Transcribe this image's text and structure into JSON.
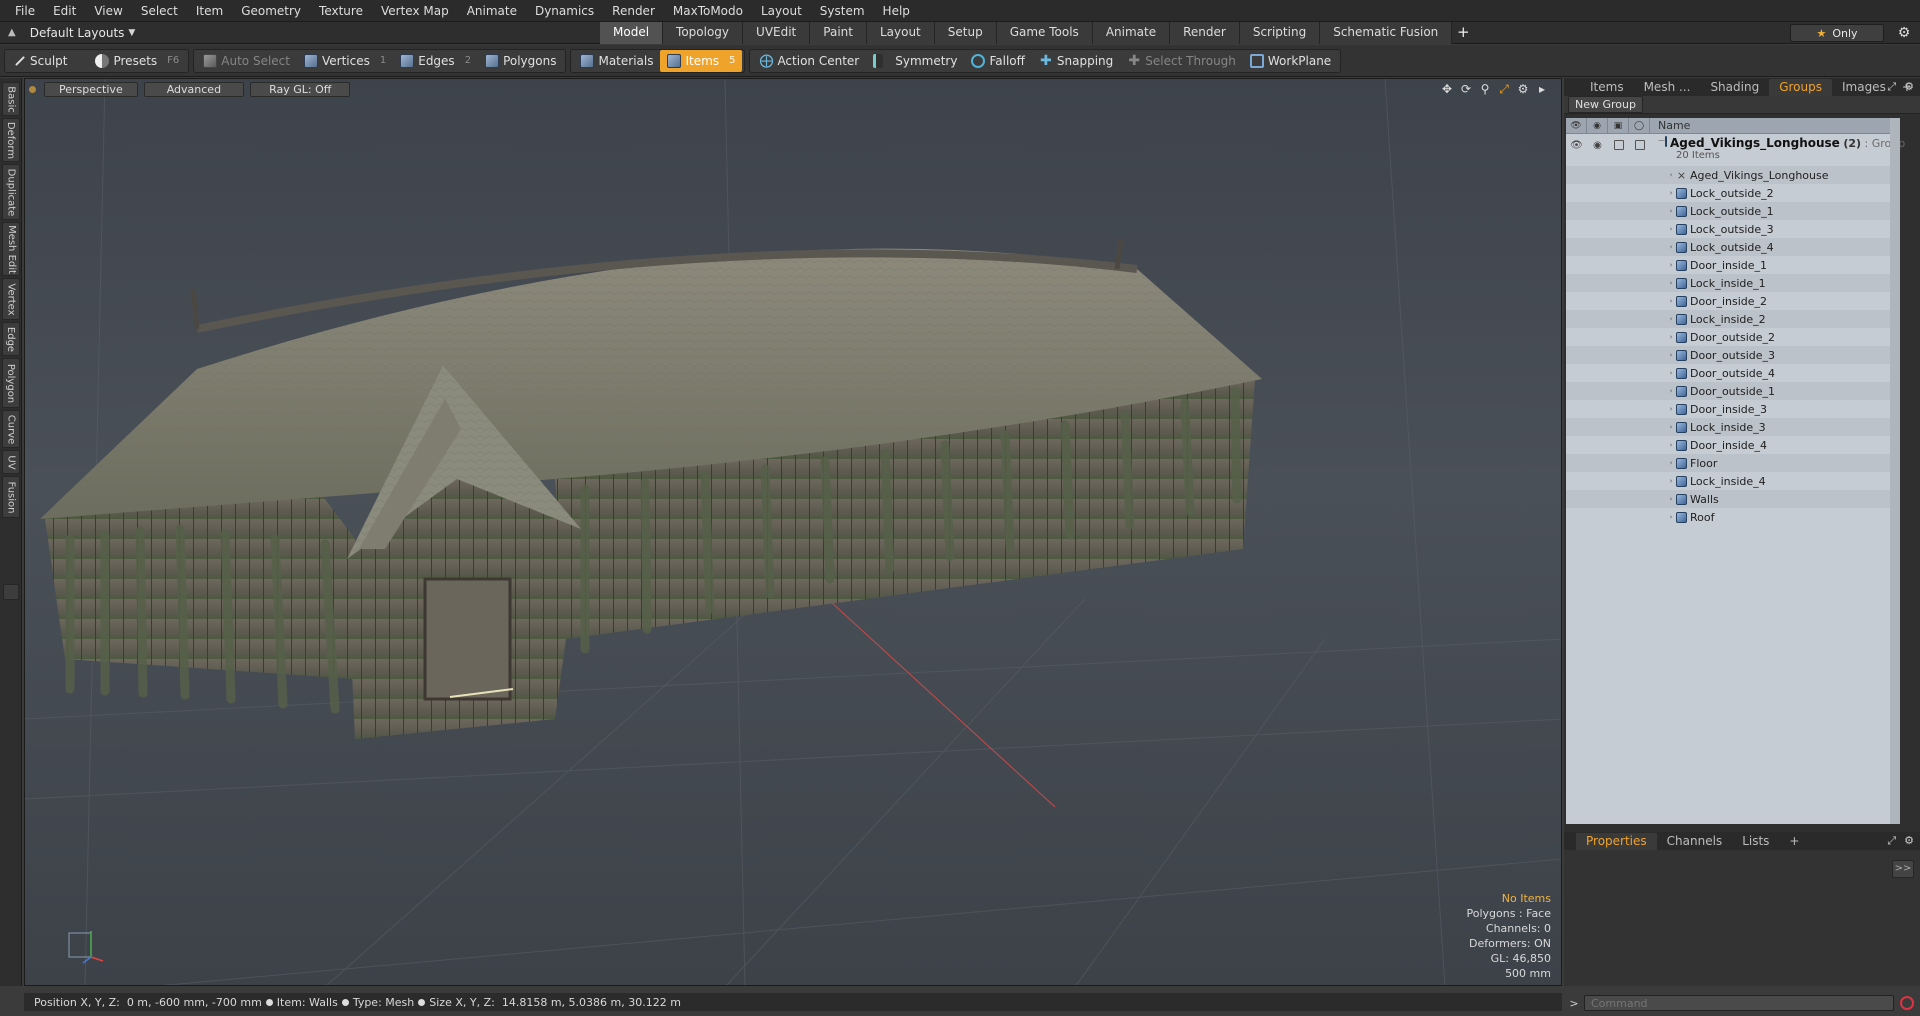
{
  "menu": [
    "File",
    "Edit",
    "View",
    "Select",
    "Item",
    "Geometry",
    "Texture",
    "Vertex Map",
    "Animate",
    "Dynamics",
    "Render",
    "MaxToModo",
    "Layout",
    "System",
    "Help"
  ],
  "layout_bar": {
    "layouts_label": "Default Layouts",
    "tabs": [
      "Model",
      "Topology",
      "UVEdit",
      "Paint",
      "Layout",
      "Setup",
      "Game Tools",
      "Animate",
      "Render",
      "Scripting",
      "Schematic Fusion"
    ],
    "active_tab": "Model",
    "add": "+",
    "only_label": "Only"
  },
  "toolbar": {
    "sculpt": "Sculpt",
    "presets": "Presets",
    "presets_key": "F6",
    "auto_select": "Auto Select",
    "vertices": "Vertices",
    "vertices_key": "1",
    "edges": "Edges",
    "edges_key": "2",
    "polygons": "Polygons",
    "materials": "Materials",
    "items": "Items",
    "items_key": "5",
    "action_center": "Action Center",
    "symmetry": "Symmetry",
    "falloff": "Falloff",
    "snapping": "Snapping",
    "select_through": "Select Through",
    "workplane": "WorkPlane"
  },
  "left_tabs": [
    "Basic",
    "Deform",
    "Duplicate",
    "Mesh Edit",
    "Vertex",
    "Edge",
    "Polygon",
    "Curve",
    "UV",
    "Fusion"
  ],
  "viewport": {
    "view_mode": "Perspective",
    "shading": "Advanced",
    "raygl": "Ray GL: Off",
    "info": {
      "no_items": "No Items",
      "polygons": "Polygons : Face",
      "channels": "Channels: 0",
      "deformers": "Deformers: ON",
      "gl": "GL: 46,850",
      "scale": "500 mm"
    }
  },
  "right_panel": {
    "tabs": [
      "Items",
      "Mesh ...",
      "Shading",
      "Groups",
      "Images"
    ],
    "active_tab": "Groups",
    "new_group": "New Group",
    "column_name": "Name",
    "group": {
      "name": "Aged_Vikings_Longhouse",
      "count": "(2)",
      "type": ": Group",
      "subtitle": "20 Items"
    },
    "items": [
      {
        "label": "Aged_Vikings_Longhouse",
        "kind": "locator"
      },
      {
        "label": "Lock_outside_2",
        "kind": "mesh"
      },
      {
        "label": "Lock_outside_1",
        "kind": "mesh"
      },
      {
        "label": "Lock_outside_3",
        "kind": "mesh"
      },
      {
        "label": "Lock_outside_4",
        "kind": "mesh"
      },
      {
        "label": "Door_inside_1",
        "kind": "mesh"
      },
      {
        "label": "Lock_inside_1",
        "kind": "mesh"
      },
      {
        "label": "Door_inside_2",
        "kind": "mesh"
      },
      {
        "label": "Lock_inside_2",
        "kind": "mesh"
      },
      {
        "label": "Door_outside_2",
        "kind": "mesh"
      },
      {
        "label": "Door_outside_3",
        "kind": "mesh"
      },
      {
        "label": "Door_outside_4",
        "kind": "mesh"
      },
      {
        "label": "Door_outside_1",
        "kind": "mesh"
      },
      {
        "label": "Door_inside_3",
        "kind": "mesh"
      },
      {
        "label": "Lock_inside_3",
        "kind": "mesh"
      },
      {
        "label": "Door_inside_4",
        "kind": "mesh"
      },
      {
        "label": "Floor",
        "kind": "mesh"
      },
      {
        "label": "Lock_inside_4",
        "kind": "mesh"
      },
      {
        "label": "Walls",
        "kind": "mesh"
      },
      {
        "label": "Roof",
        "kind": "mesh"
      }
    ],
    "bottom_tabs": [
      "Properties",
      "Channels",
      "Lists"
    ],
    "bottom_active": "Properties",
    "expand": ">>"
  },
  "status": {
    "position_label": "Position X, Y, Z:",
    "position_value": "0 m, -600 mm, -700 mm",
    "item_label": "Item:",
    "item_value": "Walls",
    "type_label": "Type:",
    "type_value": "Mesh",
    "size_label": "Size X, Y, Z:",
    "size_value": "14.8158 m, 5.0386 m, 30.122 m"
  },
  "command": {
    "arrow": ">",
    "placeholder": "Command"
  },
  "colors": {
    "accent": "#f0a32b",
    "menubar": "#2b2b2b",
    "tree_bg": "#c6ccd3"
  }
}
